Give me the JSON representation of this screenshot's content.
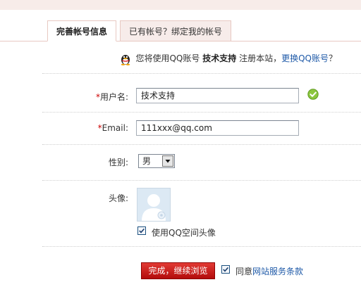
{
  "tabs": [
    {
      "label": "完善帐号信息",
      "active": true
    },
    {
      "label": "已有帐号？绑定我的帐号",
      "active": false
    }
  ],
  "notice": {
    "prefix": "您将使用QQ账号",
    "account": "技术支持",
    "middle": "注册本站，",
    "link": "更换QQ账号",
    "suffix": "？",
    "icon": "qq-penguin-icon"
  },
  "form": {
    "username": {
      "required_mark": "*",
      "label": "用户名:",
      "value": "技术支持",
      "valid_icon": "check-circle-icon"
    },
    "email": {
      "required_mark": "*",
      "label": "Email:",
      "value": "111xxx@qq.com"
    },
    "gender": {
      "label": "性别:",
      "selected": "男"
    },
    "avatar": {
      "label": "头像:",
      "use_qzone_label": "使用QQ空间头像",
      "use_qzone_checked": true
    }
  },
  "submit": {
    "button_label": "完成，继续浏览",
    "agree_prefix": "同意",
    "agree_link": "网站服务条款",
    "agree_checked": true
  },
  "colors": {
    "accent_red": "#c0100f",
    "link_blue": "#1f5aa8",
    "required_red": "#cc0000",
    "tab_border": "#e8c9c2"
  }
}
